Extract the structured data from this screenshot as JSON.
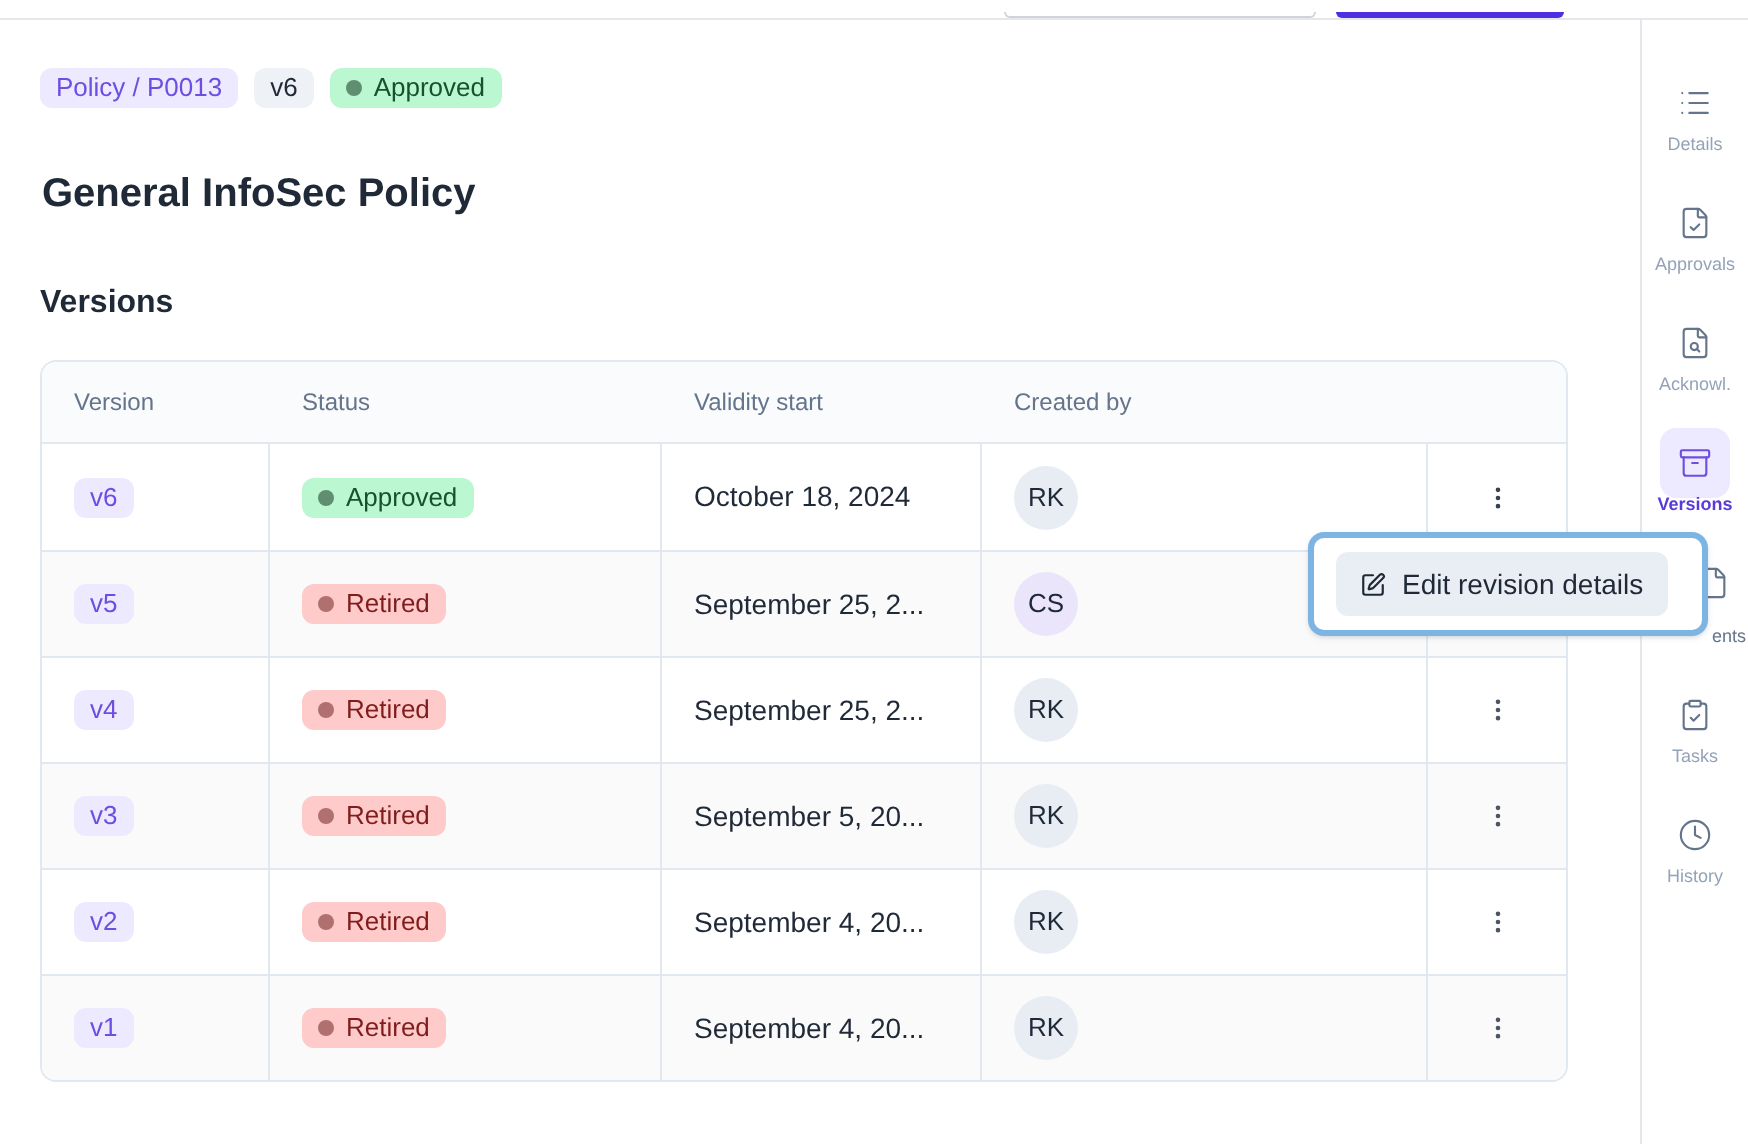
{
  "breadcrumb": {
    "path": "Policy / P0013",
    "version": "v6",
    "status": {
      "label": "Approved",
      "kind": "approved"
    }
  },
  "title": "General InfoSec Policy",
  "section_title": "Versions",
  "table": {
    "columns": [
      "Version",
      "Status",
      "Validity start",
      "Created by"
    ],
    "rows": [
      {
        "version": "v6",
        "status": {
          "label": "Approved",
          "kind": "approved"
        },
        "validity_start": "October 18, 2024",
        "created_by": {
          "initials": "RK",
          "kind": "gray"
        },
        "menu_open": true
      },
      {
        "version": "v5",
        "status": {
          "label": "Retired",
          "kind": "retired"
        },
        "validity_start": "September 25, 2...",
        "created_by": {
          "initials": "CS",
          "kind": "purple"
        },
        "menu_open": false
      },
      {
        "version": "v4",
        "status": {
          "label": "Retired",
          "kind": "retired"
        },
        "validity_start": "September 25, 2...",
        "created_by": {
          "initials": "RK",
          "kind": "gray"
        },
        "menu_open": false
      },
      {
        "version": "v3",
        "status": {
          "label": "Retired",
          "kind": "retired"
        },
        "validity_start": "September 5, 20...",
        "created_by": {
          "initials": "RK",
          "kind": "gray"
        },
        "menu_open": false
      },
      {
        "version": "v2",
        "status": {
          "label": "Retired",
          "kind": "retired"
        },
        "validity_start": "September 4, 20...",
        "created_by": {
          "initials": "RK",
          "kind": "gray"
        },
        "menu_open": false
      },
      {
        "version": "v1",
        "status": {
          "label": "Retired",
          "kind": "retired"
        },
        "validity_start": "September 4, 20...",
        "created_by": {
          "initials": "RK",
          "kind": "gray"
        },
        "menu_open": false
      }
    ]
  },
  "row_menu": {
    "items": [
      "Edit revision details"
    ]
  },
  "sidebar": {
    "items": [
      {
        "label": "Details",
        "selected": false
      },
      {
        "label": "Approvals",
        "selected": false
      },
      {
        "label": "Acknowl.",
        "selected": false
      },
      {
        "label": "Versions",
        "selected": true
      },
      {
        "label": "ents",
        "selected": false
      },
      {
        "label": "Tasks",
        "selected": false
      },
      {
        "label": "History",
        "selected": false
      }
    ]
  }
}
